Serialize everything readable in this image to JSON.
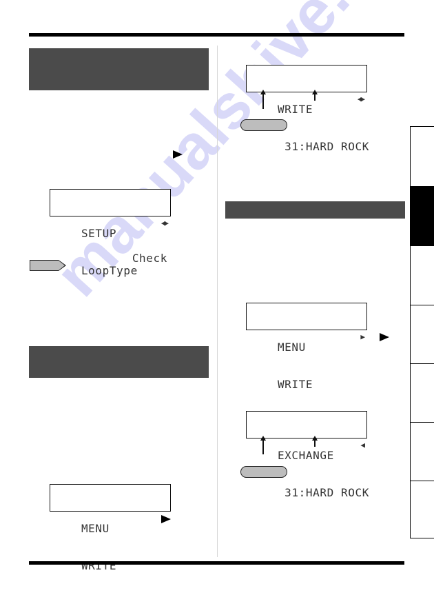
{
  "page": {
    "watermark": "manualshive.com"
  },
  "left_column": {
    "section_1": {
      "title": ""
    },
    "lcd_setup": {
      "line1": "SETUP",
      "line1_indicator": "◀▶",
      "line2_left": "LoopType",
      "line2_right": "Check"
    },
    "note_tag_label": "",
    "section_2": {
      "title": ""
    },
    "lcd_menu": {
      "line1": "MENU",
      "line1_indicator": "▶",
      "line2": "WRITE"
    }
  },
  "right_column": {
    "lcd_write": {
      "line1": "WRITE",
      "line1_indicator": "◀▶",
      "line2": " 31:HARD ROCK"
    },
    "pill_label_1": "",
    "section_3": {
      "title": ""
    },
    "lcd_menu": {
      "line1": "MENU",
      "line1_indicator": "▶",
      "line2": "WRITE"
    },
    "lcd_exchange": {
      "line1": "EXCHANGE",
      "line1_indicator": "◀",
      "line2": " 31:HARD ROCK"
    },
    "pill_label_2": ""
  },
  "side_index": {
    "tabs": [
      {
        "label": "",
        "active": false
      },
      {
        "label": "",
        "active": true
      },
      {
        "label": "",
        "active": false
      },
      {
        "label": "",
        "active": false
      },
      {
        "label": "",
        "active": false
      },
      {
        "label": "",
        "active": false
      },
      {
        "label": "",
        "active": false
      }
    ]
  },
  "icons": {
    "cursor_button": "play-triangle-icon",
    "pointer": "arrow-up-icon"
  }
}
